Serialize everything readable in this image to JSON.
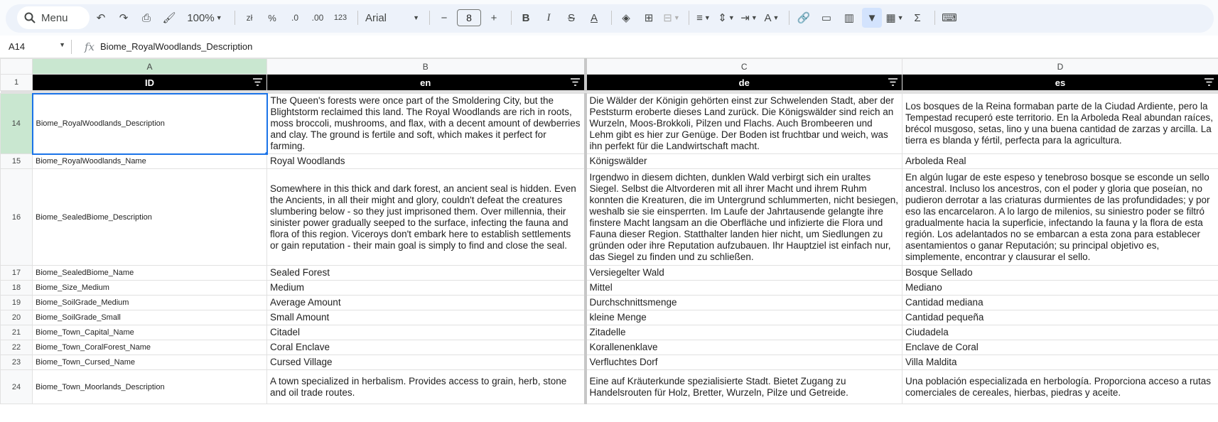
{
  "toolbar": {
    "menu_label": "Menu",
    "zoom": "100%",
    "currency": "zł",
    "percent": "%",
    "dec_decrease": ".0",
    "dec_increase": ".00",
    "number_format": "123",
    "font": "Arial",
    "font_size": "8",
    "bold": "B",
    "italic": "I"
  },
  "formula_bar": {
    "name_box": "A14",
    "fx": "fx",
    "content": "Biome_RoyalWoodlands_Description"
  },
  "columns": [
    "A",
    "B",
    "C",
    "D"
  ],
  "header_row": {
    "num": "1",
    "cells": [
      "ID",
      "en",
      "de",
      "es"
    ]
  },
  "rows": [
    {
      "num": "14",
      "id": "Biome_RoyalWoodlands_Description",
      "en": "The Queen's forests were once part of the Smoldering City, but the Blightstorm reclaimed this land. The Royal Woodlands are rich in roots, moss broccoli, mushrooms, and flax, with a decent amount of dewberries and clay. The ground is fertile and soft, which makes it perfect for farming.",
      "de": "Die Wälder der Königin gehörten einst zur Schwelenden Stadt, aber der Peststurm eroberte dieses Land zurück. Die Königswälder sind reich an Wurzeln, Moos-Brokkoli, Pilzen und Flachs. Auch Brombeeren und Lehm gibt es hier zur Genüge. Der Boden ist fruchtbar und weich, was ihn perfekt für die Landwirtschaft macht.",
      "es": "Los bosques de la Reina formaban parte de la Ciudad Ardiente, pero la Tempestad recuperó este territorio. En la Arboleda Real abundan raíces, brécol musgoso, setas, lino y una buena cantidad de zarzas y arcilla. La tierra es blanda y fértil, perfecta para la agricultura."
    },
    {
      "num": "15",
      "id": "Biome_RoyalWoodlands_Name",
      "en": "Royal Woodlands",
      "de": "Königswälder",
      "es": "Arboleda Real"
    },
    {
      "num": "16",
      "id": "Biome_SealedBiome_Description",
      "en": "Somewhere in this thick and dark forest, an ancient seal is hidden. Even the Ancients, in all their might and glory, couldn't defeat the creatures slumbering below - so they just imprisoned them. Over millennia, their sinister power gradually seeped to the surface, infecting the fauna and flora of this region. Viceroys don't embark here to establish settlements or gain reputation - their main goal is simply to find and close the seal.",
      "de": "Irgendwo in diesem dichten, dunklen Wald verbirgt sich ein uraltes Siegel. Selbst die Altvorderen mit all ihrer Macht und ihrem Ruhm konnten die Kreaturen, die im Untergrund schlummerten, nicht besiegen, weshalb sie sie einsperrten. Im Laufe der Jahrtausende gelangte ihre finstere Macht langsam an die Oberfläche und infizierte die Flora und Fauna dieser Region. Statthalter landen hier nicht, um Siedlungen zu gründen oder ihre Reputation aufzubauen. Ihr Hauptziel ist einfach nur, das Siegel zu finden und zu schließen.",
      "es": "En algún lugar de este espeso y tenebroso bosque se esconde un sello ancestral. Incluso los ancestros, con el poder y gloria que poseían, no pudieron derrotar a las criaturas durmientes de las profundidades; y por eso las encarcelaron. A lo largo de milenios, su siniestro poder se filtró gradualmente hacia la superficie, infectando la fauna y la flora de esta región. Los adelantados no se embarcan a esta zona para establecer asentamientos o ganar Reputación; su principal objetivo es, simplemente, encontrar y clausurar el sello."
    },
    {
      "num": "17",
      "id": "Biome_SealedBiome_Name",
      "en": "Sealed Forest",
      "de": "Versiegelter Wald",
      "es": "Bosque Sellado"
    },
    {
      "num": "18",
      "id": "Biome_Size_Medium",
      "en": "Medium",
      "de": "Mittel",
      "es": "Mediano"
    },
    {
      "num": "19",
      "id": "Biome_SoilGrade_Medium",
      "en": "Average Amount",
      "de": "Durchschnittsmenge",
      "es": "Cantidad mediana"
    },
    {
      "num": "20",
      "id": "Biome_SoilGrade_Small",
      "en": "Small Amount",
      "de": "kleine Menge",
      "es": "Cantidad pequeña"
    },
    {
      "num": "21",
      "id": "Biome_Town_Capital_Name",
      "en": "Citadel",
      "de": "Zitadelle",
      "es": "Ciudadela"
    },
    {
      "num": "22",
      "id": "Biome_Town_CoralForest_Name",
      "en": "Coral Enclave",
      "de": "Korallenenklave",
      "es": "Enclave de Coral"
    },
    {
      "num": "23",
      "id": "Biome_Town_Cursed_Name",
      "en": "Cursed Village",
      "de": "Verfluchtes Dorf",
      "es": "Villa Maldita"
    },
    {
      "num": "24",
      "id": "Biome_Town_Moorlands_Description",
      "en": "A town specialized in herbalism. Provides access to grain, herb, stone and oil trade routes.",
      "de": "Eine auf Kräuterkunde spezialisierte Stadt. Bietet Zugang zu Handelsrouten für Holz, Bretter, Wurzeln, Pilze und Getreide.",
      "es": "Una población especializada en herbología. Proporciona acceso a rutas comerciales de cereales, hierbas, piedras y aceite."
    }
  ]
}
